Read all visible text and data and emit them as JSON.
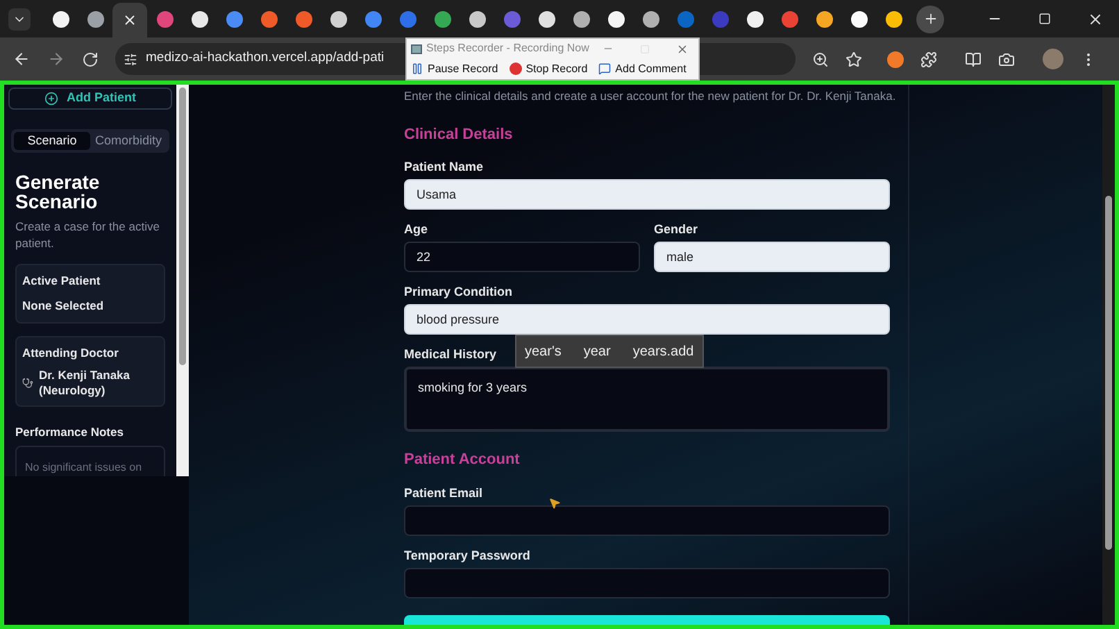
{
  "browser": {
    "tabs": [
      {
        "color": "#f2f2f2",
        "selected": false
      },
      {
        "color": "#9aa0a6",
        "selected": false
      },
      {
        "selected": true
      },
      {
        "color": "#e0457b",
        "selected": false
      },
      {
        "color": "#e8e8e8",
        "selected": false
      },
      {
        "color": "#4b8bf5",
        "selected": false
      },
      {
        "color": "#f05a28",
        "selected": false
      },
      {
        "color": "#f05a28",
        "selected": false
      },
      {
        "color": "#d0d0d0",
        "selected": false
      },
      {
        "color": "#4285f4",
        "selected": false
      },
      {
        "color": "#2e6fe8",
        "selected": false
      },
      {
        "color": "#34a853",
        "selected": false
      },
      {
        "color": "#c8c8c8",
        "selected": false
      },
      {
        "color": "#6b5bd6",
        "selected": false
      },
      {
        "color": "#e0e0e0",
        "selected": false
      },
      {
        "color": "#b0b0b0",
        "selected": false
      },
      {
        "color": "#f5f5f5",
        "selected": false
      },
      {
        "color": "#b0b0b0",
        "selected": false
      },
      {
        "color": "#0a66c2",
        "selected": false
      },
      {
        "color": "#3b3bbf",
        "selected": false
      },
      {
        "color": "#f0f0f0",
        "selected": false
      },
      {
        "color": "#ea4335",
        "selected": false
      },
      {
        "color": "#f5a623",
        "selected": false
      },
      {
        "color": "#fbfbfb",
        "selected": false
      },
      {
        "color": "#fbbc05",
        "selected": false
      }
    ],
    "url": "medizo-ai-hackathon.vercel.app/add-pati"
  },
  "recorder": {
    "title": "Steps Recorder - Recording Now",
    "buttons": [
      {
        "label": "Pause Record",
        "kind": "pause"
      },
      {
        "label": "Stop Record",
        "kind": "stop"
      },
      {
        "label": "Add Comment",
        "kind": "comment"
      }
    ]
  },
  "sidebar": {
    "add_button": "Add Patient",
    "tabs": [
      {
        "label": "Scenario",
        "selected": true
      },
      {
        "label": "Comorbidity",
        "selected": false
      }
    ],
    "heading": "Generate Scenario",
    "description": "Create a case for the active patient.",
    "cards": [
      {
        "title": "Active Patient",
        "value": "None Selected",
        "kind": "plain"
      },
      {
        "title": "Attending Doctor",
        "value": "Dr. Kenji Tanaka (Neurology)",
        "kind": "doctor"
      }
    ],
    "notes": {
      "title": "Performance Notes",
      "text": "No significant issues on"
    }
  },
  "form": {
    "intro": "Enter the clinical details and create a user account for the new patient for Dr. Dr. Kenji Tanaka.",
    "sections": [
      {
        "title": "Clinical Details",
        "rows": [
          [
            {
              "label": "Patient Name",
              "value": "Usama",
              "kind": "input",
              "autofilled": true,
              "focused": false
            }
          ],
          [
            {
              "label": "Age",
              "value": "22",
              "kind": "input",
              "autofilled": false,
              "focused": false
            },
            {
              "label": "Gender",
              "value": "male",
              "kind": "input",
              "autofilled": true,
              "focused": false
            }
          ],
          [
            {
              "label": "Primary Condition",
              "value": "blood pressure",
              "kind": "input",
              "autofilled": true,
              "focused": false
            }
          ],
          [
            {
              "label": "Medical History",
              "value": "smoking for 3 years",
              "kind": "textarea",
              "autofilled": false,
              "focused": true,
              "suggestions": [
                "year's",
                "year",
                "years.add"
              ]
            }
          ]
        ]
      },
      {
        "title": "Patient Account",
        "rows": [
          [
            {
              "label": "Patient Email",
              "kind": "input",
              "autofilled": false,
              "focused": false
            }
          ],
          [
            {
              "label": "Temporary Password",
              "kind": "input",
              "autofilled": false,
              "focused": false
            }
          ]
        ]
      }
    ]
  }
}
